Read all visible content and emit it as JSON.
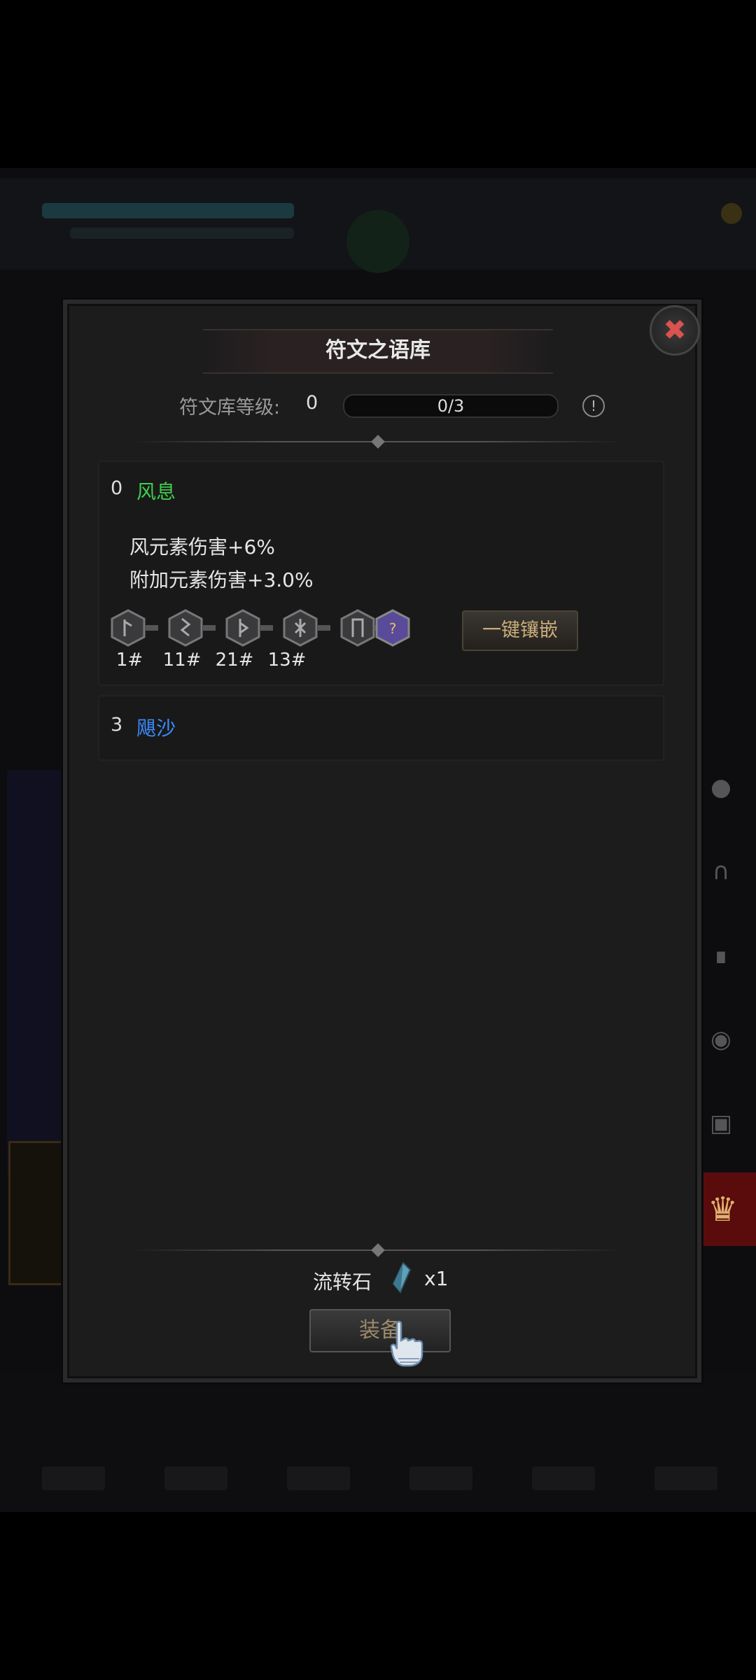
{
  "dialog": {
    "title": "符文之语库",
    "close_icon": "close-icon",
    "level": {
      "label": "符文库等级:",
      "value": "0",
      "progress_text": "0/3",
      "progress_fraction": 0,
      "info_icon": "info-icon"
    },
    "runewords": [
      {
        "count": "0",
        "name": "风息",
        "name_color": "#3ecf4a",
        "effects": [
          "风元素伤害+6%",
          "附加元素伤害+3.0%"
        ],
        "runes": [
          {
            "label": "1#",
            "icon": "rune-icon"
          },
          {
            "label": "11#",
            "icon": "rune-icon"
          },
          {
            "label": "21#",
            "icon": "rune-icon"
          },
          {
            "label": "13#",
            "icon": "rune-icon"
          },
          {
            "label": "",
            "icon": "rune-icon"
          },
          {
            "label": "",
            "icon": "mystery-rune-icon"
          }
        ],
        "inlay_button": "一键镶嵌"
      },
      {
        "count": "3",
        "name": "飓沙",
        "name_color": "#3a8cff"
      }
    ],
    "footer": {
      "stone_label": "流转石",
      "stone_icon": "crystal-icon",
      "stone_count": "x1",
      "equip_button": "装备",
      "cursor_icon": "hand-pointer-icon"
    }
  },
  "side_slots": [
    {
      "icon": "helmet-icon"
    },
    {
      "icon": "pants-icon"
    },
    {
      "icon": "boots-icon"
    },
    {
      "icon": "gauntlet-icon"
    },
    {
      "icon": "armor-icon"
    },
    {
      "icon": "spartan-helm-icon",
      "active": true
    }
  ]
}
